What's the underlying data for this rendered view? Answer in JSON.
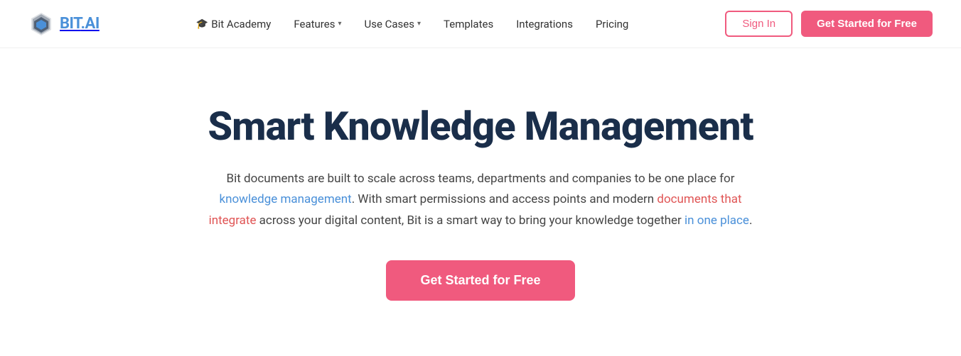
{
  "logo": {
    "text_bit": "BIT",
    "text_ai": ".AI",
    "alt": "Bit.ai Logo"
  },
  "navbar": {
    "items": [
      {
        "label": "Bit Academy",
        "icon": "🎓",
        "has_dropdown": false
      },
      {
        "label": "Features",
        "has_dropdown": true
      },
      {
        "label": "Use Cases",
        "has_dropdown": true
      },
      {
        "label": "Templates",
        "has_dropdown": false
      },
      {
        "label": "Integrations",
        "has_dropdown": false
      },
      {
        "label": "Pricing",
        "has_dropdown": false
      }
    ],
    "signin_label": "Sign In",
    "cta_label": "Get Started for Free"
  },
  "hero": {
    "title": "Smart Knowledge Management",
    "description_part1": "Bit documents are built to scale across teams, departments and companies to be one place for ",
    "description_link1": "knowledge management",
    "description_part2": ". With smart permissions and access points and modern ",
    "description_link2": "documents that integrate",
    "description_part3": " across your digital content, Bit is a smart way to bring your knowledge together ",
    "description_link3": "in one place",
    "description_part4": ".",
    "cta_label": "Get Started for Free"
  },
  "colors": {
    "accent_pink": "#f05a7e",
    "accent_blue": "#4a90d9",
    "accent_red": "#e05555",
    "dark_navy": "#1a2e4a"
  }
}
